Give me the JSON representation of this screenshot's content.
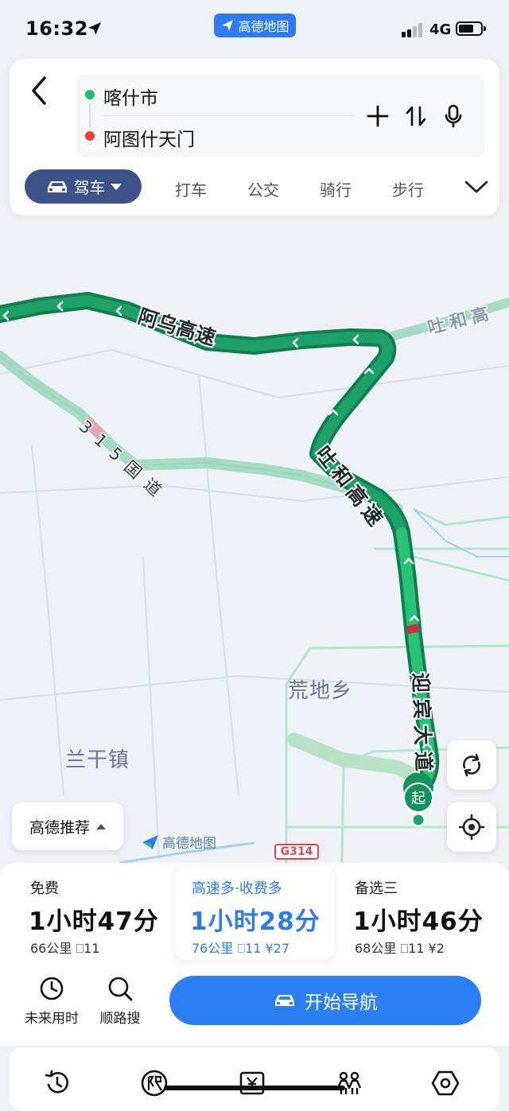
{
  "status_bar": {
    "time": "16:32",
    "network": "4G",
    "app_badge": "高德地图"
  },
  "route_input": {
    "origin": "喀什市",
    "destination": "阿图什天门"
  },
  "modes": {
    "selected": "驾车",
    "items": [
      "打车",
      "公交",
      "骑行",
      "步行"
    ]
  },
  "map": {
    "road_labels": [
      "阿乌高速",
      "吐和高速",
      "315国道",
      "迎宾大道",
      "吐和高"
    ],
    "place_labels": [
      "荒地乡",
      "兰干镇"
    ],
    "start_marker": "起",
    "highway_shield": "G314",
    "watermark": "高德地图",
    "recommend_label": "高德推荐"
  },
  "route_options": [
    {
      "tag": "免费",
      "time": "1小时47分",
      "distance": "66公里",
      "lights": "11",
      "toll": ""
    },
    {
      "tag": "高速多·收费多",
      "time": "1小时28分",
      "distance": "76公里",
      "lights": "11",
      "toll": "¥27"
    },
    {
      "tag": "备选三",
      "time": "1小时46分",
      "distance": "68公里",
      "lights": "11",
      "toll": "¥2"
    }
  ],
  "actions": {
    "future": "未来用时",
    "along": "顺路搜",
    "navigate": "开始导航"
  },
  "colors": {
    "route_main": "#128a5a",
    "route_alt": "#a6dcc5",
    "accent": "#2a7ff5",
    "mode_pill": "#3c5288"
  }
}
